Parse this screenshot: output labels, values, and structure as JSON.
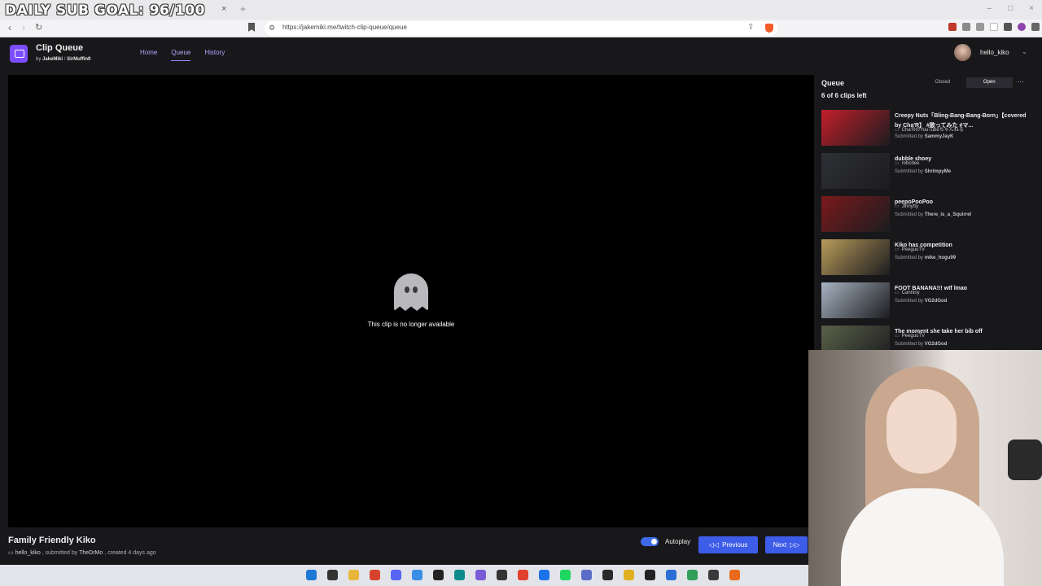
{
  "browser": {
    "stream_overlay_text": "DAILY SUB GOAL: 96/100",
    "tab_close": "×",
    "new_tab": "+",
    "back": "‹",
    "forward": "›",
    "reload": "↻",
    "url": "https://jakemiki.me/twitch-clip-queue/queue",
    "window_controls": [
      "–",
      "□",
      "×"
    ]
  },
  "app": {
    "title": "Clip Queue",
    "credit_by": "by",
    "credit_author_1": "JakeMiki",
    "credit_sep": "/",
    "credit_author_2": "SirMuffin9",
    "nav": [
      "Home",
      "Queue",
      "History"
    ],
    "active_nav": "Queue",
    "username": "hello_kiko",
    "user_menu_chevron": "⌄"
  },
  "player": {
    "message": "This clip is no longer available"
  },
  "current_clip": {
    "title": "Family Friendly Kiko",
    "channel": "hello_kiko",
    "submitted_label": ", submitted by",
    "submitter": "TheDrMo",
    "created": ", created 4 days ago"
  },
  "controls": {
    "autoplay_label": "Autoplay",
    "autoplay_on": true,
    "previous_label": "Previous",
    "next_label": "Next"
  },
  "queue": {
    "title": "Queue",
    "closed_label": "Closed",
    "open_label": "Open",
    "state": "Open",
    "more": "⋯",
    "clips_left": "6 of 6 clips left",
    "submitted_prefix": "Submitted by",
    "items": [
      {
        "title": "Creepy Nuts「Bling-Bang-Bang-Born」【covered by Cha'R】 #歌ってみた #マ...",
        "channel": "Cha'RのYouTubeちゃんねる",
        "submitter": "SammyJayK",
        "thumb_color": "#c21e2b"
      },
      {
        "title": "dubble shoey",
        "channel": "robcdee",
        "submitter": "ShrimpyMe",
        "thumb_color": "#2e3035"
      },
      {
        "title": "peepoPooPoo",
        "channel": "Jinnytty",
        "submitter": "There_is_a_Squirrel",
        "thumb_color": "#7a1a1c"
      },
      {
        "title": "Kiko has competition",
        "channel": "PeeguuTV",
        "submitter": "mike_hogu99",
        "thumb_color": "#b89a5a"
      },
      {
        "title": "FOOT BANANA!!! wtf lmao",
        "channel": "Canniny",
        "submitter": "VG2dGod",
        "thumb_color": "#a8b4c2"
      },
      {
        "title": "The moment she take her bib off",
        "channel": "PeeguuTV",
        "submitter": "VG2dGod",
        "thumb_color": "#5a6048"
      }
    ]
  },
  "taskbar": {
    "icon_colors": [
      "#1e78d6",
      "#333333",
      "#e8b73a",
      "#d8432d",
      "#5865f2",
      "#3a8ee6",
      "#222222",
      "#0f8b8d",
      "#7a5cd6",
      "#333333",
      "#e0412c",
      "#1a73e8",
      "#1ed760",
      "#5a6ec8",
      "#2a2a2a",
      "#e0b020",
      "#222222",
      "#2b6fd6",
      "#2f9f5a",
      "#3a3a3a",
      "#e86a1a"
    ]
  }
}
